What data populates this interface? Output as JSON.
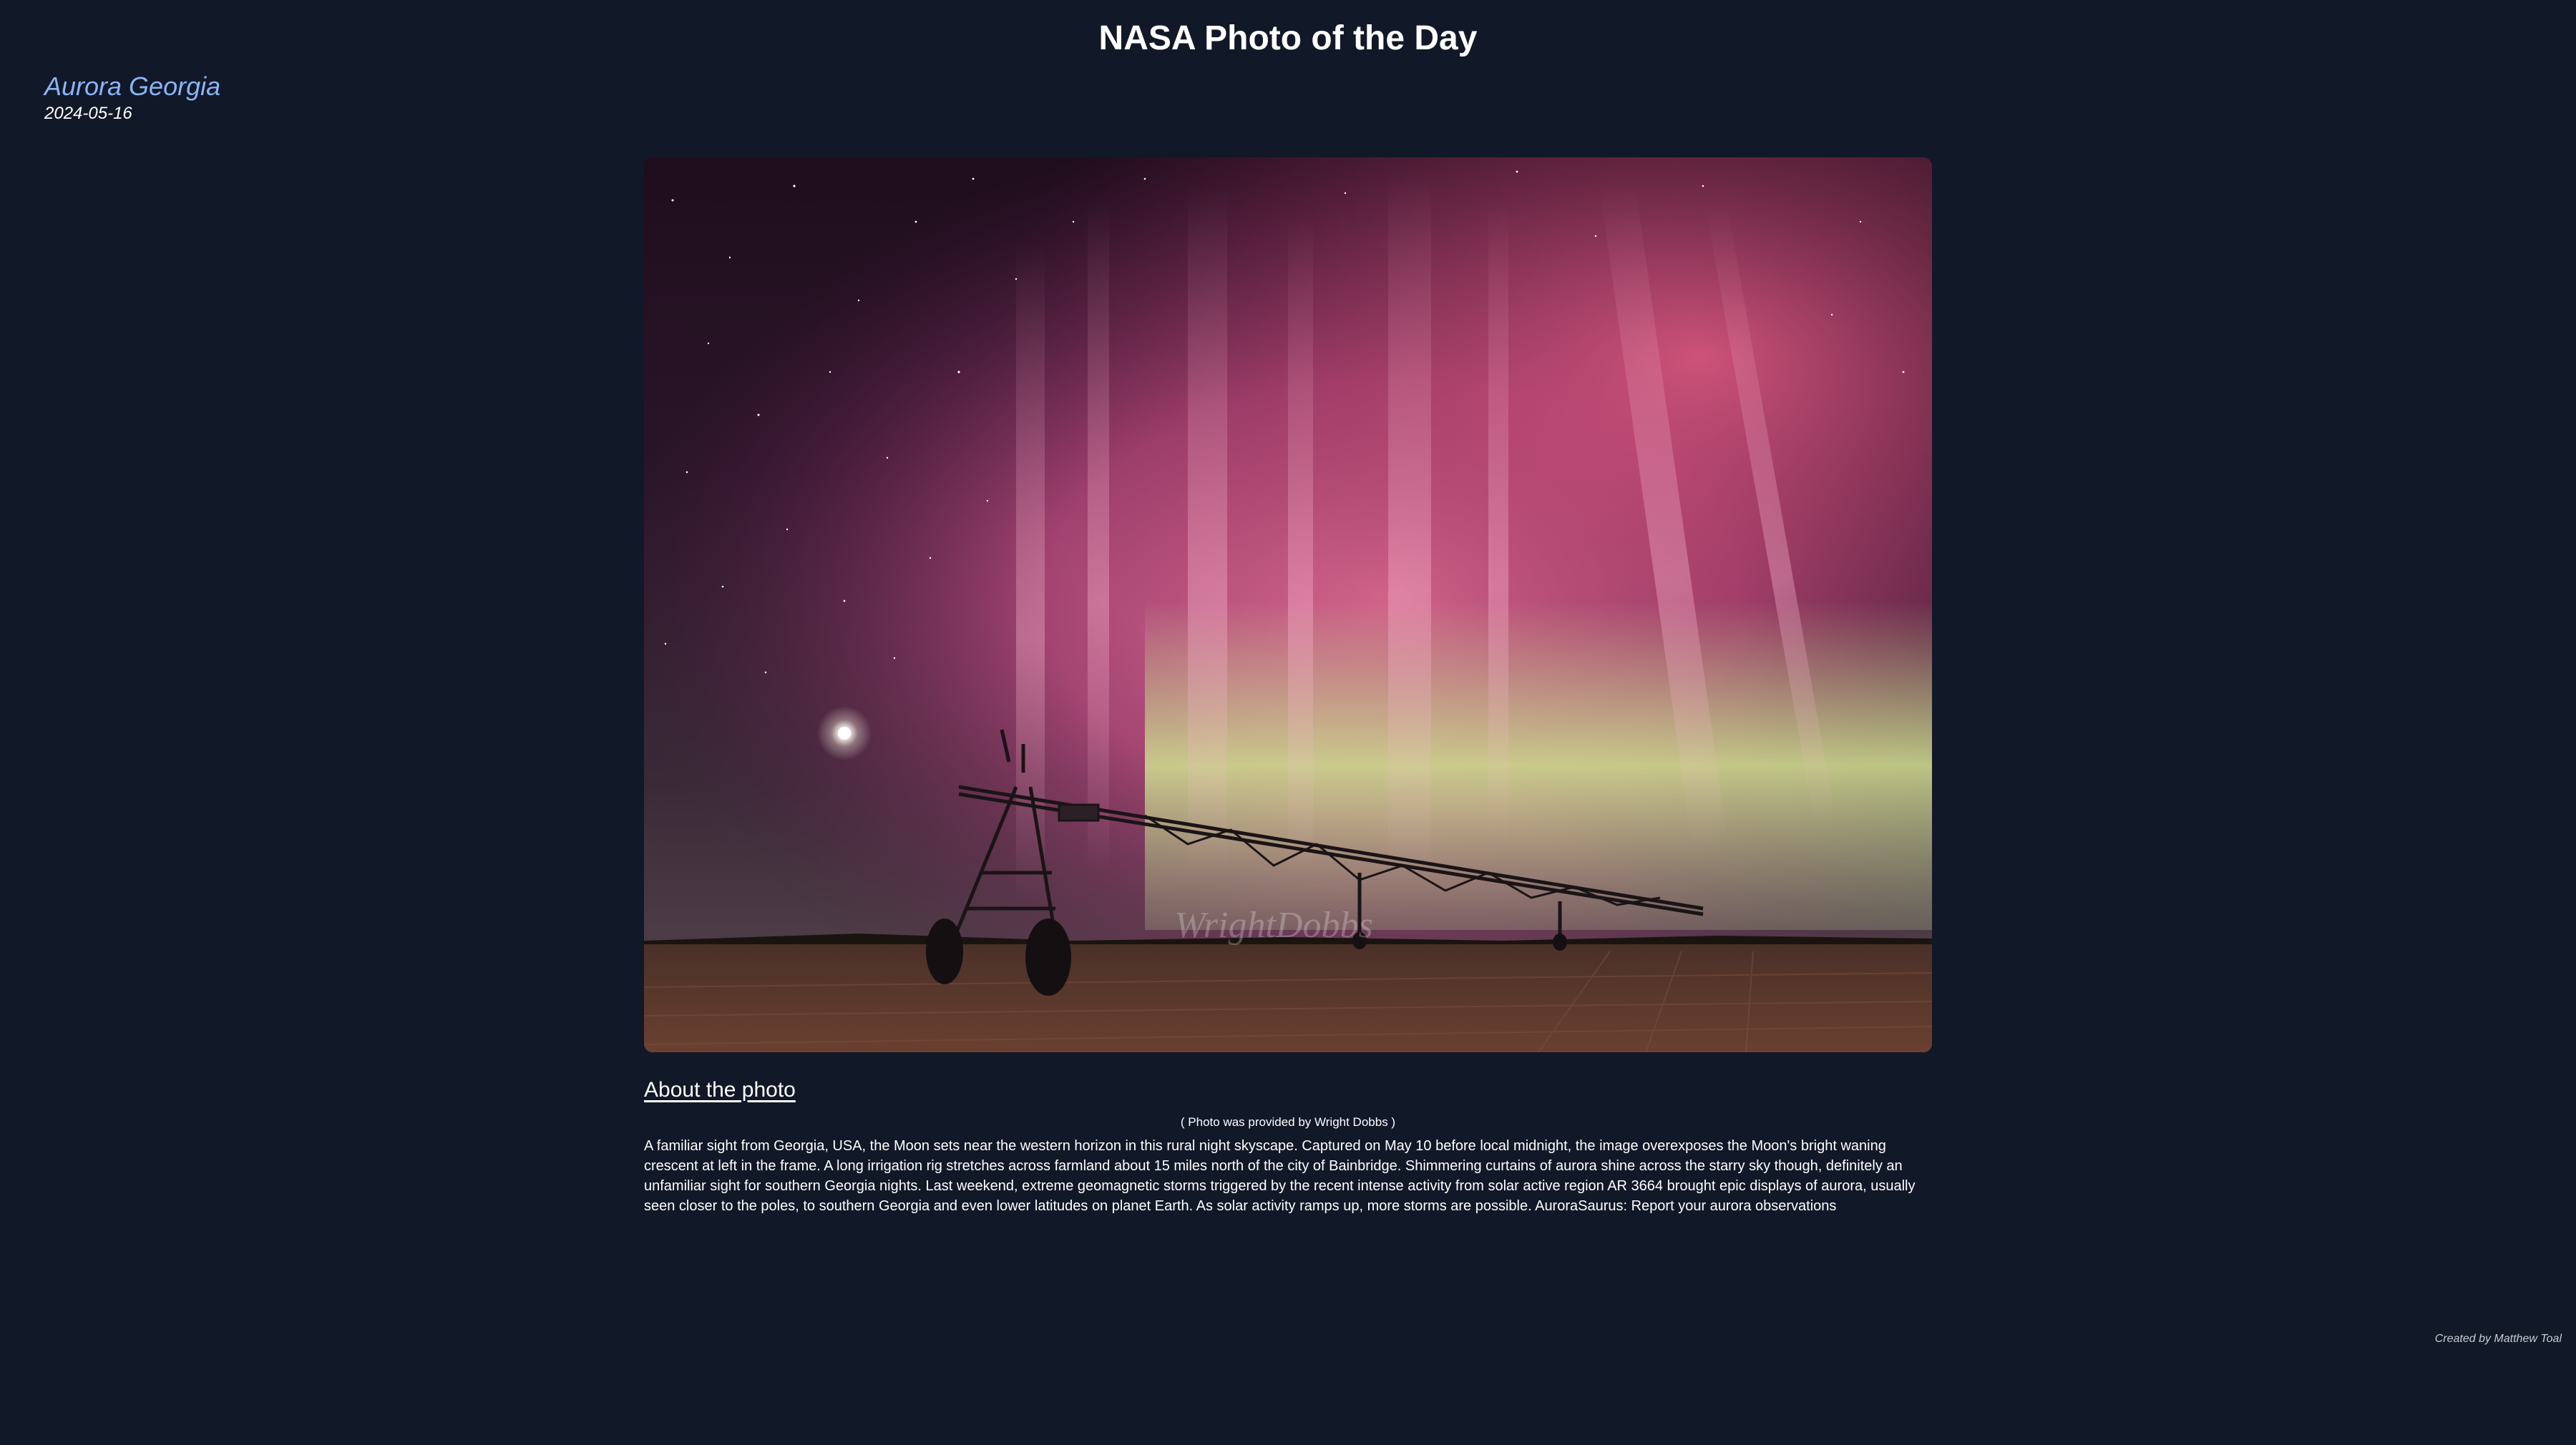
{
  "header": {
    "title": "NASA Photo of the Day"
  },
  "photo": {
    "title": "Aurora Georgia",
    "date": "2024-05-16",
    "watermark": "WrightDobbs"
  },
  "about": {
    "heading": "About the photo",
    "credit": "( Photo was provided by Wright Dobbs )",
    "description": "A familiar sight from Georgia, USA, the Moon sets near the western horizon in this rural night skyscape. Captured on May 10 before local midnight, the image overexposes the Moon's bright waning crescent at left in the frame. A long irrigation rig stretches across farmland about 15 miles north of the city of Bainbridge. Shimmering curtains of aurora shine across the starry sky though, definitely an unfamiliar sight for southern Georgia nights. Last weekend, extreme geomagnetic storms triggered by the recent intense activity from solar active region AR 3664 brought epic displays of aurora, usually seen closer to the poles, to southern Georgia and even lower latitudes on planet Earth. As solar activity ramps up, more storms are possible. AuroraSaurus: Report your aurora observations"
  },
  "footer": {
    "text": "Created by Matthew Toal"
  },
  "colors": {
    "background": "#111827",
    "title_accent": "#8ab4f8",
    "aurora_pink": "#e0608a",
    "aurora_green": "#c8d890"
  }
}
